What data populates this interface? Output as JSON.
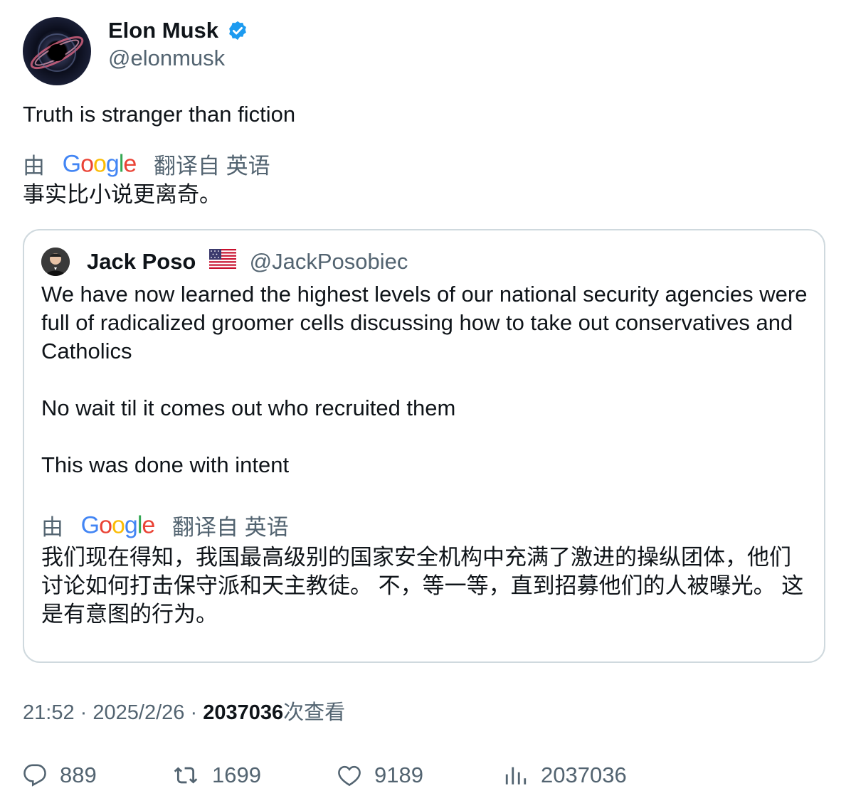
{
  "author": {
    "name": "Elon Musk",
    "handle": "@elonmusk",
    "verified_icon": "verified-badge-icon",
    "accent_color": "#1d9bf0"
  },
  "tweet": {
    "text": "Truth is stranger than fiction",
    "translation": {
      "prefix": "由",
      "provider": "Google",
      "suffix": "翻译自 英语",
      "text": "事实比小说更离奇。"
    }
  },
  "quote": {
    "name": "Jack Poso",
    "flag_icon": "us-flag-icon",
    "handle": "@JackPosobiec",
    "text": "We have now learned the highest levels of our national security agencies were full of radicalized groomer cells discussing how to take out conservatives and Catholics\n\nNo wait til it comes out who recruited them\n\nThis was done with intent",
    "translation": {
      "prefix": "由",
      "provider": "Google",
      "suffix": "翻译自 英语",
      "text": "我们现在得知，我国最高级别的国家安全机构中充满了激进的操纵团体，他们讨论如何打击保守派和天主教徒。 不，等一等，直到招募他们的人被曝光。 这是有意图的行为。"
    }
  },
  "meta": {
    "time": "21:52",
    "separator": "·",
    "date": "2025/2/26",
    "views_count": "2037036",
    "views_label": "次查看"
  },
  "actions": {
    "replies": "889",
    "retweets": "1699",
    "likes": "9189",
    "views": "2037036"
  }
}
